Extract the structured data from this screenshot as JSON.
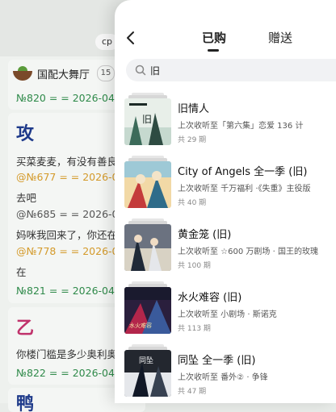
{
  "background_chat": {
    "top_pill": "cp",
    "room_name": "国配大舞厅",
    "room_count": "15",
    "card1_ref": "№820 = = 2026-04-03",
    "card2_char": "攻",
    "card2_line1": "买菜麦麦，有没有善良",
    "card2_line2": "@№677 = = 2026-04",
    "card2_line3": "去吧",
    "card2_line4": "@№685 = = 2026-04",
    "card2_line5": "妈咪我回来了，你还在",
    "card2_line6": "@№778 = = 2026-04",
    "card2_line7": "在",
    "card2_ref": "№821 = = 2026-04-03",
    "card3_char": "乙",
    "card3_line1": "你楼门槛是多少奥利奥",
    "card3_ref": "№822 = = 2026-04-03",
    "card4_char": "鸭"
  },
  "panel": {
    "tabs": [
      {
        "label": "已购",
        "active": true
      },
      {
        "label": "赠送",
        "active": false
      }
    ],
    "search": {
      "value": "旧",
      "icon": "search-icon"
    },
    "items": [
      {
        "title": "旧情人",
        "last": "上次收听至「第六集」恋爱 136 计",
        "count": "共 29 期"
      },
      {
        "title": "City of Angels 全一季 (旧)",
        "last": "上次收听至 千万福利 ·《失重》主役版",
        "count": "共 40 期"
      },
      {
        "title": "黄金笼 (旧)",
        "last": "上次收听至 ☆600 万剧场 · 国王的玫瑰",
        "count": "共 100 期"
      },
      {
        "title": "水火难容 (旧)",
        "last": "上次收听至 小剧场 · 斯诺克",
        "count": "共 113 期"
      },
      {
        "title": "同坠 全一季 (旧)",
        "last": "上次收听至 番外② · 争锋",
        "count": "共 47 期"
      }
    ]
  },
  "colors": {
    "ref_green": "#2f8a4a",
    "warn_orange": "#d49a2a",
    "active_tab": "#222222"
  }
}
